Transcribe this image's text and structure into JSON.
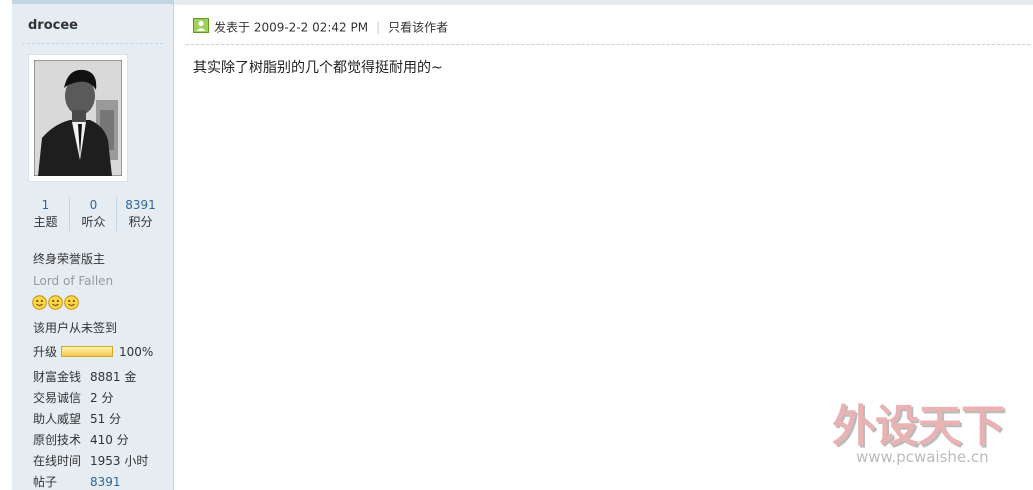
{
  "user": {
    "username": "drocee",
    "stats": [
      {
        "value": "1",
        "label": "主题"
      },
      {
        "value": "0",
        "label": "听众"
      },
      {
        "value": "8391",
        "label": "积分"
      }
    ],
    "rank_title": "终身荣誉版主",
    "rank_english": "Lord of Fallen",
    "rank_icons": [
      "smiley-icon",
      "smiley-icon",
      "smiley-icon"
    ],
    "signin_status": "该用户从未签到",
    "upgrade_label": "升级",
    "upgrade_progress": "100%",
    "profile": [
      {
        "key": "财富金钱",
        "value": "8881 金"
      },
      {
        "key": "交易诚信",
        "value": "2 分"
      },
      {
        "key": "助人威望",
        "value": "51 分"
      },
      {
        "key": "原创技术",
        "value": "410 分"
      },
      {
        "key": "在线时间",
        "value": "1953 小时"
      },
      {
        "key": "帖子",
        "value": "8391"
      }
    ]
  },
  "post": {
    "icon": "post-status-icon",
    "posted_at": "发表于 2009-2-2 02:42 PM",
    "author_only_link": "只看该作者",
    "content": "其实除了树脂别的几个都觉得挺耐用的~"
  },
  "watermark": {
    "chinese": "外设天下",
    "url": "www.pcwaishe.cn"
  },
  "colors": {
    "sidebar_bg": "#e5edf2",
    "border": "#c2d5e3",
    "link": "#336699",
    "watermark_red": "#e9b3b3"
  }
}
